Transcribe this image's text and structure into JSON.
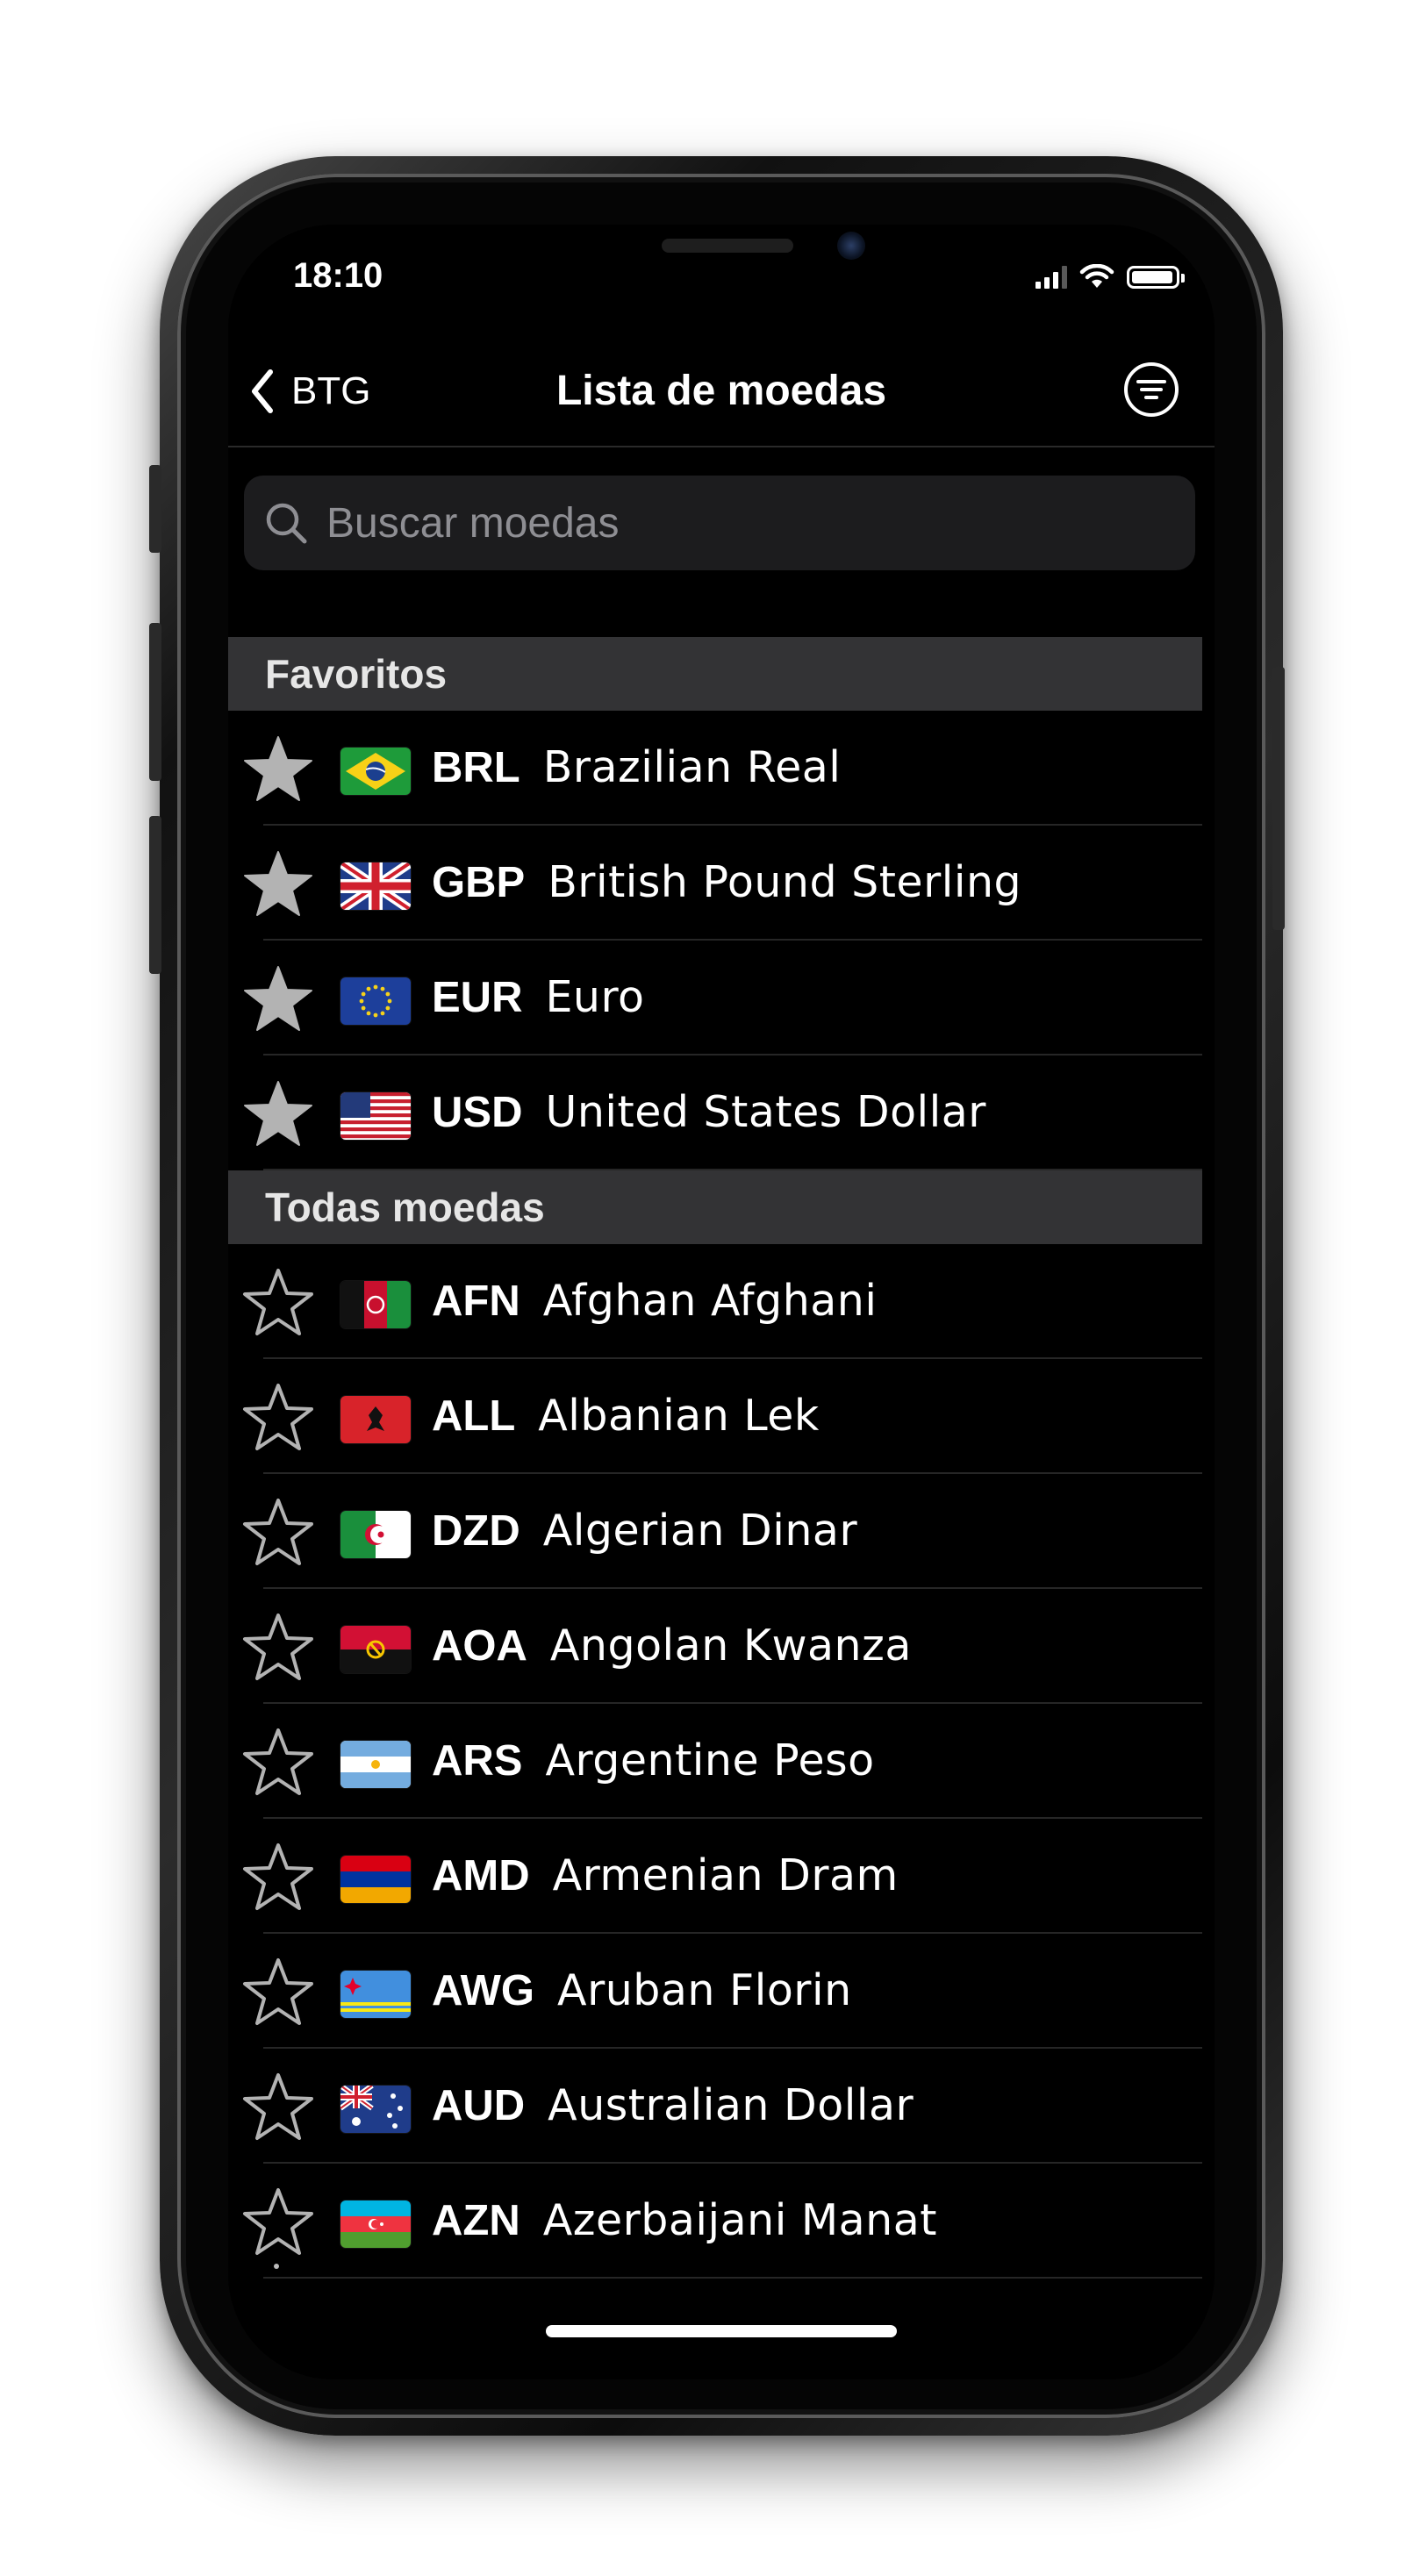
{
  "status": {
    "time": "18:10"
  },
  "nav": {
    "back_label": "BTG",
    "title": "Lista de moedas"
  },
  "search": {
    "placeholder": "Buscar moedas"
  },
  "sections": {
    "favorites": "Favoritos",
    "all": "Todas moedas"
  },
  "favorites": [
    {
      "code": "BRL",
      "name": "Brazilian Real",
      "flag": "brazil-flag-icon",
      "starred": true
    },
    {
      "code": "GBP",
      "name": "British Pound Sterling",
      "flag": "uk-flag-icon",
      "starred": true
    },
    {
      "code": "EUR",
      "name": "Euro",
      "flag": "eu-flag-icon",
      "starred": true
    },
    {
      "code": "USD",
      "name": "United States Dollar",
      "flag": "us-flag-icon",
      "starred": true
    }
  ],
  "all_currencies": [
    {
      "code": "AFN",
      "name": "Afghan Afghani",
      "flag": "afghanistan-flag-icon",
      "starred": false
    },
    {
      "code": "ALL",
      "name": "Albanian Lek",
      "flag": "albania-flag-icon",
      "starred": false
    },
    {
      "code": "DZD",
      "name": "Algerian Dinar",
      "flag": "algeria-flag-icon",
      "starred": false
    },
    {
      "code": "AOA",
      "name": "Angolan Kwanza",
      "flag": "angola-flag-icon",
      "starred": false
    },
    {
      "code": "ARS",
      "name": "Argentine Peso",
      "flag": "argentina-flag-icon",
      "starred": false
    },
    {
      "code": "AMD",
      "name": "Armenian Dram",
      "flag": "armenia-flag-icon",
      "starred": false
    },
    {
      "code": "AWG",
      "name": "Aruban Florin",
      "flag": "aruba-flag-icon",
      "starred": false
    },
    {
      "code": "AUD",
      "name": "Australian Dollar",
      "flag": "australia-flag-icon",
      "starred": false
    },
    {
      "code": "AZN",
      "name": "Azerbaijani Manat",
      "flag": "azerbaijan-flag-icon",
      "starred": false
    }
  ],
  "colors": {
    "background": "#000000",
    "section_header": "#333335",
    "search_field": "#1c1c1e",
    "star_filled": "#b3b3b3",
    "text": "#ffffff"
  }
}
